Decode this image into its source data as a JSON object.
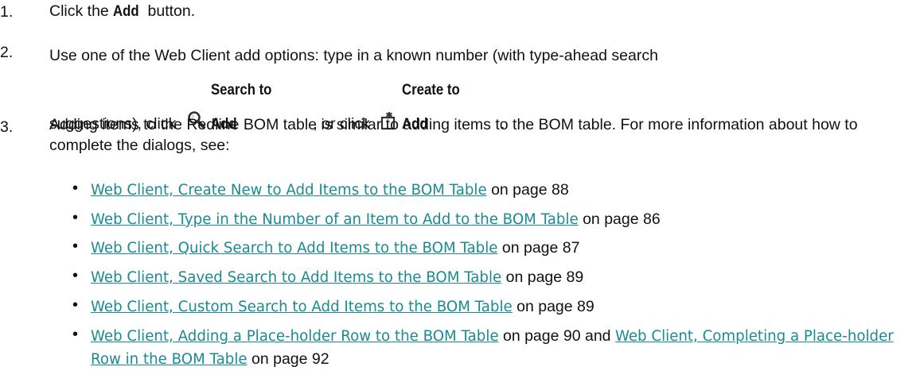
{
  "steps": [
    {
      "number": "1.",
      "text_before": "Click the ",
      "bold": "Add",
      "text_after": " button."
    },
    {
      "number": "2.",
      "line1": "Use one of the Web Client add options: type in a known number (with type-ahead search",
      "line2_prefix": "suggestions), click",
      "search_label": "Search to Add",
      "between": ", or click",
      "create_label": "Create to Add",
      "end": "."
    },
    {
      "number": "3.",
      "text": "Adding items to the Redline BOM table is similar to adding items to the BOM table. For more information about how to complete the dialogs, see:"
    }
  ],
  "bullets": [
    {
      "link": "Web Client, Create New to Add Items to the BOM Table",
      "suffix": " on page 88"
    },
    {
      "link": "Web Client, Type in the Number of an Item to Add to the BOM Table",
      "suffix": " on page 86"
    },
    {
      "link": "Web Client, Quick Search to Add Items to the BOM Table",
      "suffix": " on page 87"
    },
    {
      "link": "Web Client, Saved Search to Add Items to the BOM Table",
      "suffix": " on page 89"
    },
    {
      "link": "Web Client, Custom Search to Add Items to the BOM Table",
      "suffix": " on page 89"
    },
    {
      "link": "Web Client, Adding a Place-holder Row to the BOM Table",
      "middle": " on page 90 and ",
      "link2": "Web Client, Completing a Place-holder Row in the BOM Table",
      "suffix": " on page 92"
    }
  ],
  "icons": {
    "search": "search-icon",
    "create": "create-new-icon"
  },
  "colors": {
    "text": "#111111",
    "link": "#1a8a93"
  },
  "bullet_char": "•"
}
